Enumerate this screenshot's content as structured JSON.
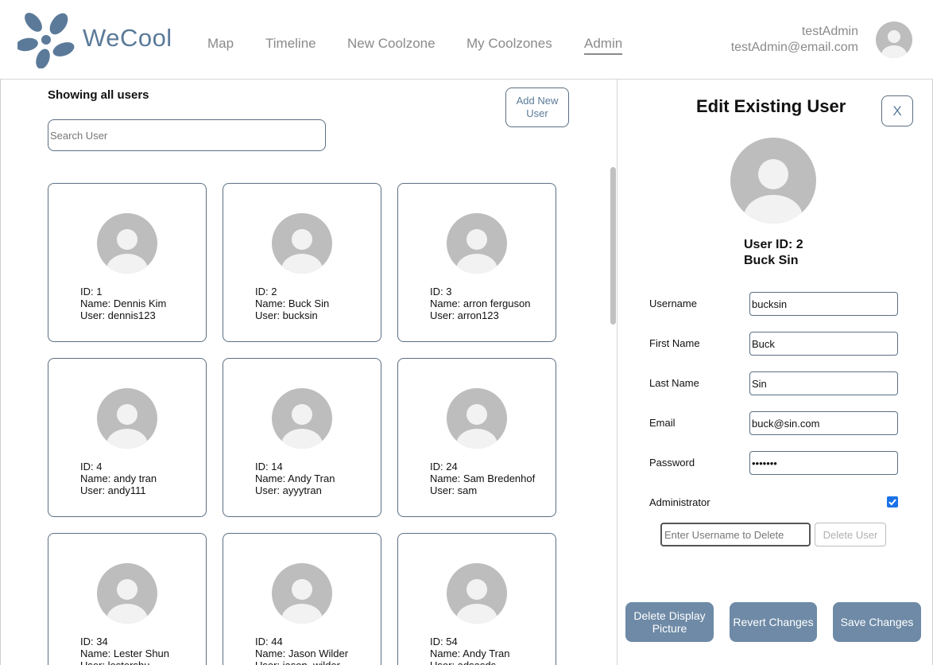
{
  "app": {
    "brand": "WeCool",
    "brand_color": "#5b7a99"
  },
  "nav": {
    "items": [
      "Map",
      "Timeline",
      "New Coolzone",
      "My Coolzones",
      "Admin"
    ],
    "active": "Admin"
  },
  "account": {
    "username": "testAdmin",
    "email": "testAdmin@email.com"
  },
  "list": {
    "title": "Showing all users",
    "search_placeholder": "Search User",
    "add_button": "Add New User"
  },
  "users": [
    {
      "id": "ID: 1",
      "name": "Name: Dennis Kim",
      "user": "User: dennis123"
    },
    {
      "id": "ID: 2",
      "name": "Name: Buck Sin",
      "user": "User: bucksin"
    },
    {
      "id": "ID: 3",
      "name": "Name: arron ferguson",
      "user": "User: arron123"
    },
    {
      "id": "ID: 4",
      "name": "Name: andy tran",
      "user": "User: andy111"
    },
    {
      "id": "ID: 14",
      "name": "Name: Andy Tran",
      "user": "User: ayyytran"
    },
    {
      "id": "ID: 24",
      "name": "Name: Sam Bredenhof",
      "user": "User: sam"
    },
    {
      "id": "ID: 34",
      "name": "Name: Lester Shun",
      "user": "User: lestershu"
    },
    {
      "id": "ID: 44",
      "name": "Name: Jason Wilder",
      "user": "User: jason_wilder"
    },
    {
      "id": "ID: 54",
      "name": "Name: Andy Tran",
      "user": "User: adsasds"
    }
  ],
  "edit": {
    "title": "Edit Existing User",
    "close_label": "X",
    "user_id_label": "User ID: 2",
    "full_name": "Buck Sin",
    "fields": {
      "username": {
        "label": "Username",
        "value": "bucksin"
      },
      "first_name": {
        "label": "First Name",
        "value": "Buck"
      },
      "last_name": {
        "label": "Last Name",
        "value": "Sin"
      },
      "email": {
        "label": "Email",
        "value": "buck@sin.com"
      },
      "password": {
        "label": "Password",
        "value": "bucksin"
      }
    },
    "admin_label": "Administrator",
    "admin_checked": true,
    "delete_placeholder": "Enter Username to Delete",
    "delete_button": "Delete User",
    "delete_picture_button": "Delete Display Picture",
    "revert_button": "Revert Changes",
    "save_button": "Save Changes",
    "button_color": "#6e8aa6"
  }
}
